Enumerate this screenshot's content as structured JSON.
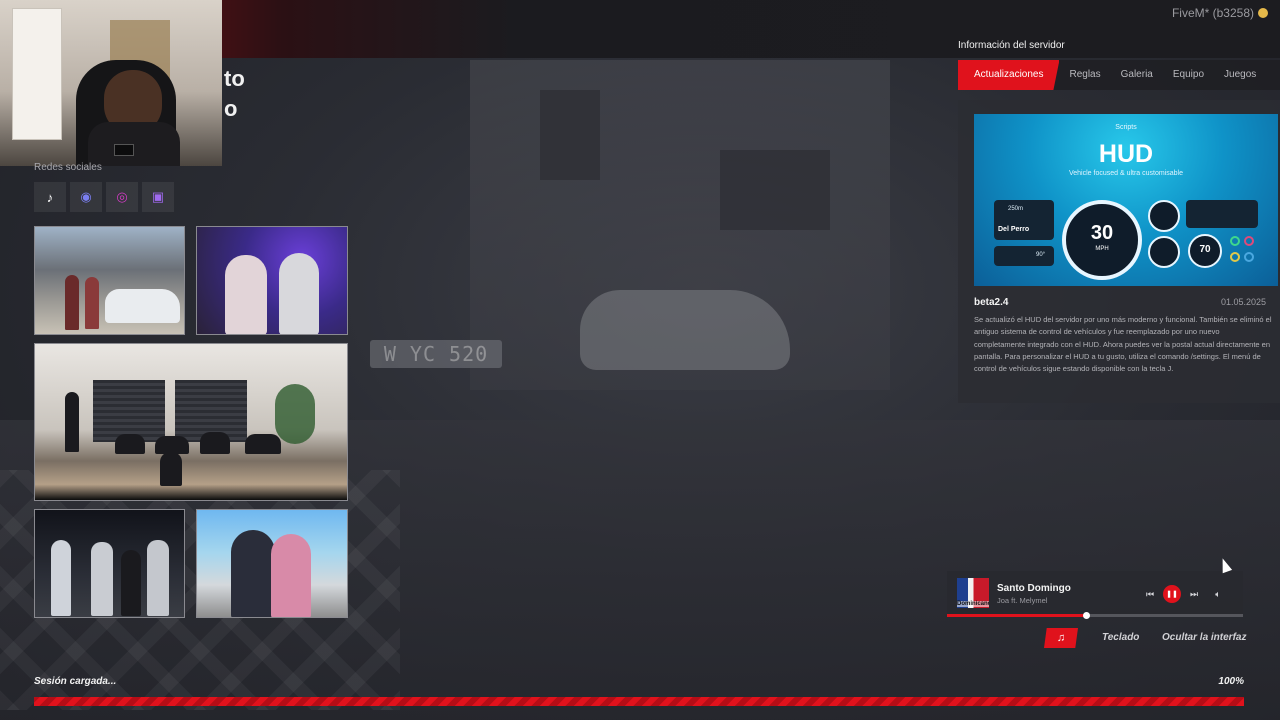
{
  "app": {
    "client_badge": "FiveM* (b3258)",
    "title_fragment_line1": "to",
    "title_fragment_line2": "o"
  },
  "social": {
    "label": "Redes sociales",
    "items": [
      {
        "name": "tiktok",
        "glyph": "♪",
        "color": "#ffffff"
      },
      {
        "name": "discord",
        "glyph": "◉",
        "color": "#7b7ff0"
      },
      {
        "name": "instagram",
        "glyph": "◎",
        "color": "#d43bc5"
      },
      {
        "name": "twitch",
        "glyph": "▣",
        "color": "#a06af0"
      }
    ]
  },
  "server_panel": {
    "title": "Información del servidor",
    "tabs": [
      {
        "label": "Actualizaciones",
        "active": true
      },
      {
        "label": "Reglas",
        "active": false
      },
      {
        "label": "Galeria",
        "active": false
      },
      {
        "label": "Equipo",
        "active": false
      },
      {
        "label": "Juegos",
        "active": false
      }
    ],
    "update": {
      "banner": {
        "brand": "Scripts",
        "title": "HUD",
        "subtitle": "Vehicle focused & ultra customisable",
        "distance": "250m",
        "location": "Del Perro",
        "heading": "90°",
        "speed": "30",
        "speed_unit": "MPH",
        "gauge2": "70"
      },
      "version": "beta2.4",
      "date": "01.05.2025",
      "body": "Se actualizó el HUD del servidor por uno más moderno y funcional. También se eliminó el antiguo sistema de control de vehículos y fue reemplazado por uno nuevo completamente integrado con el HUD. Ahora puedes ver la postal actual directamente en pantalla. Para personalizar el HUD a tu gusto, utiliza el comando /settings. El menú de control de vehículos sigue estando disponible con la tecla J."
    }
  },
  "player": {
    "song": "Santo Domingo",
    "artist": "Joa ft. Melymel",
    "cover_text": "Dominicano",
    "progress": 0.47,
    "state": "playing",
    "icons": [
      "prev-icon",
      "pause-icon",
      "next-icon",
      "volume-icon"
    ]
  },
  "actions": {
    "music_icon": "♫",
    "keyboard": "Teclado",
    "hide_ui": "Ocultar la interfaz"
  },
  "loading": {
    "label": "Sesión cargada...",
    "percent_text": "100%",
    "progress": 1.0,
    "color": "#e0121c"
  },
  "backdrop": {
    "plate": "W YC 520"
  }
}
